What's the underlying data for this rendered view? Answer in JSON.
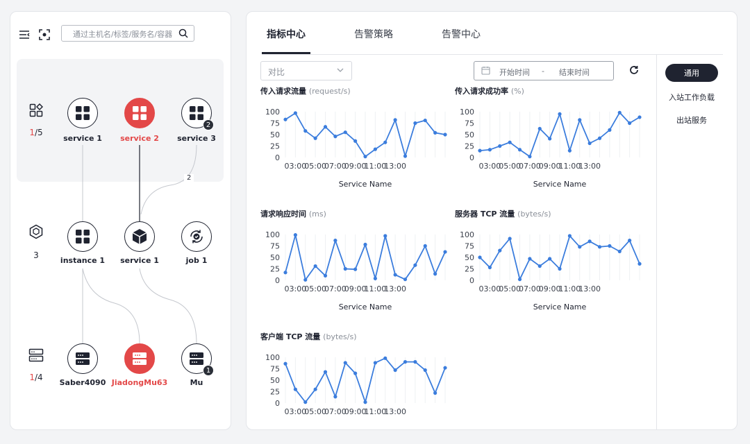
{
  "topology": {
    "search": {
      "placeholder": "通过主机名/标签/服务名/容器"
    },
    "tiers": [
      {
        "icon": "apps-icon",
        "count_highlight": "1",
        "count_rest": "/5"
      },
      {
        "icon": "hexagon-box-icon",
        "count_highlight": "",
        "count_rest": "3"
      },
      {
        "icon": "server-icon",
        "count_highlight": "1",
        "count_rest": "/4"
      }
    ],
    "nodes": [
      {
        "label": "service 1",
        "icon": "grid-apps-icon"
      },
      {
        "label": "service 2",
        "icon": "grid-apps-icon",
        "alert": true
      },
      {
        "label": "service 3",
        "icon": "grid-apps-icon",
        "badge": "2"
      },
      {
        "label": "instance 1",
        "icon": "grid-apps-icon"
      },
      {
        "label": "service 1",
        "icon": "cube-icon"
      },
      {
        "label": "job 1",
        "icon": "job-cycle-icon"
      },
      {
        "label": "Saber4090",
        "icon": "server-icon"
      },
      {
        "label": "JiadongMu63",
        "icon": "server-icon",
        "alert": true
      },
      {
        "label": "Mu",
        "icon": "server-icon",
        "badge": "1"
      }
    ],
    "edge_count_label": "2",
    "colors": {
      "alert": "#e34848",
      "ink": "#1f2330"
    }
  },
  "tabs": [
    "指标中心",
    "告警策略",
    "告警中心"
  ],
  "filters": {
    "compare_placeholder": "对比",
    "start_placeholder": "开始时间",
    "separator": "-",
    "end_placeholder": "结束时间"
  },
  "sidebar": {
    "active_button": "通用",
    "links": [
      "入站工作负载",
      "出站服务"
    ]
  },
  "charts": [
    {
      "title": "传入请求流量",
      "unit": "(request/s)",
      "xlabel": "Service Name"
    },
    {
      "title": "传入请求成功率",
      "unit": "(%)",
      "xlabel": "Service Name"
    },
    {
      "title": "请求响应时间",
      "unit": "(ms)",
      "xlabel": "Service Name"
    },
    {
      "title": "服务器 TCP 流量",
      "unit": "(bytes/s)",
      "xlabel": "Service Name"
    },
    {
      "title": "客户端 TCP 流量",
      "unit": "(bytes/s)",
      "xlabel": ""
    }
  ],
  "chart_data": [
    {
      "type": "line",
      "title": "传入请求流量 (request/s)",
      "xlabel": "Service Name",
      "ylabel": "",
      "ylim": [
        0,
        100
      ],
      "yticks": [
        "0",
        "25",
        "50",
        "75",
        "100"
      ],
      "xticks": [
        "03:00",
        "05:00",
        "07:00",
        "09:00",
        "11:00",
        "13:00"
      ],
      "line_color": "#3b7ddd",
      "series": [
        {
          "values": [
            83,
            97,
            58,
            42,
            67,
            46,
            55,
            36,
            2,
            18,
            33,
            82,
            3,
            75,
            81,
            54,
            50
          ]
        }
      ]
    },
    {
      "type": "line",
      "title": "传入请求成功率 (%)",
      "xlabel": "Service Name",
      "ylabel": "",
      "ylim": [
        0,
        100
      ],
      "yticks": [
        "0",
        "25",
        "50",
        "75",
        "100"
      ],
      "xticks": [
        "03:00",
        "05:00",
        "07:00",
        "09:00",
        "11:00",
        "13:00"
      ],
      "line_color": "#3b7ddd",
      "series": [
        {
          "values": [
            15,
            17,
            25,
            33,
            17,
            2,
            63,
            41,
            95,
            15,
            82,
            31,
            42,
            60,
            98,
            75,
            88
          ]
        }
      ]
    },
    {
      "type": "line",
      "title": "请求响应时间 (ms)",
      "xlabel": "Service Name",
      "ylabel": "",
      "ylim": [
        0,
        100
      ],
      "yticks": [
        "0",
        "25",
        "50",
        "75",
        "100"
      ],
      "xticks": [
        "03:00",
        "05:00",
        "07:00",
        "09:00",
        "11:00",
        "13:00"
      ],
      "line_color": "#3b7ddd",
      "series": [
        {
          "values": [
            17,
            99,
            1,
            31,
            10,
            87,
            25,
            24,
            78,
            4,
            97,
            12,
            2,
            33,
            75,
            14,
            62
          ]
        }
      ]
    },
    {
      "type": "line",
      "title": "服务器 TCP 流量 (bytes/s)",
      "xlabel": "Service Name",
      "ylabel": "",
      "ylim": [
        0,
        100
      ],
      "yticks": [
        "0",
        "25",
        "50",
        "75",
        "100"
      ],
      "xticks": [
        "03:00",
        "05:00",
        "07:00",
        "09:00",
        "11:00",
        "13:00"
      ],
      "line_color": "#3b7ddd",
      "series": [
        {
          "values": [
            50,
            28,
            65,
            91,
            2,
            47,
            31,
            47,
            25,
            97,
            73,
            85,
            73,
            75,
            63,
            87,
            36
          ]
        }
      ]
    },
    {
      "type": "line",
      "title": "客户端 TCP 流量 (bytes/s)",
      "xlabel": "",
      "ylabel": "",
      "ylim": [
        0,
        100
      ],
      "yticks": [
        "0",
        "25",
        "50",
        "75",
        "100"
      ],
      "xticks": [
        "03:00",
        "05:00",
        "07:00",
        "09:00",
        "11:00",
        "13:00"
      ],
      "line_color": "#3b7ddd",
      "series": [
        {
          "values": [
            86,
            30,
            2,
            30,
            68,
            14,
            88,
            65,
            2,
            88,
            98,
            72,
            90,
            90,
            72,
            22,
            77
          ]
        }
      ]
    }
  ]
}
